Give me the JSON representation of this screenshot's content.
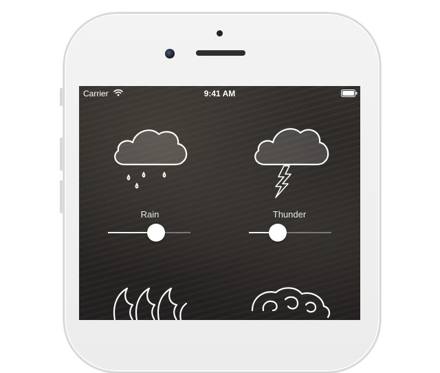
{
  "status_bar": {
    "carrier": "Carrier",
    "time": "9:41 AM",
    "wifi_icon": "wifi-icon",
    "battery_icon": "battery-icon"
  },
  "tiles": [
    {
      "label": "Rain",
      "icon": "rain-cloud-icon",
      "level": 0.58
    },
    {
      "label": "Thunder",
      "icon": "thunder-cloud-icon",
      "level": 0.35
    },
    {
      "label": "",
      "icon": "waves-icon"
    },
    {
      "label": "",
      "icon": "wind-swirl-icon"
    }
  ],
  "colors": {
    "screen_background": "#2a2826",
    "icon_stroke": "#ffffff",
    "slider_track": "#f2f2f2"
  }
}
